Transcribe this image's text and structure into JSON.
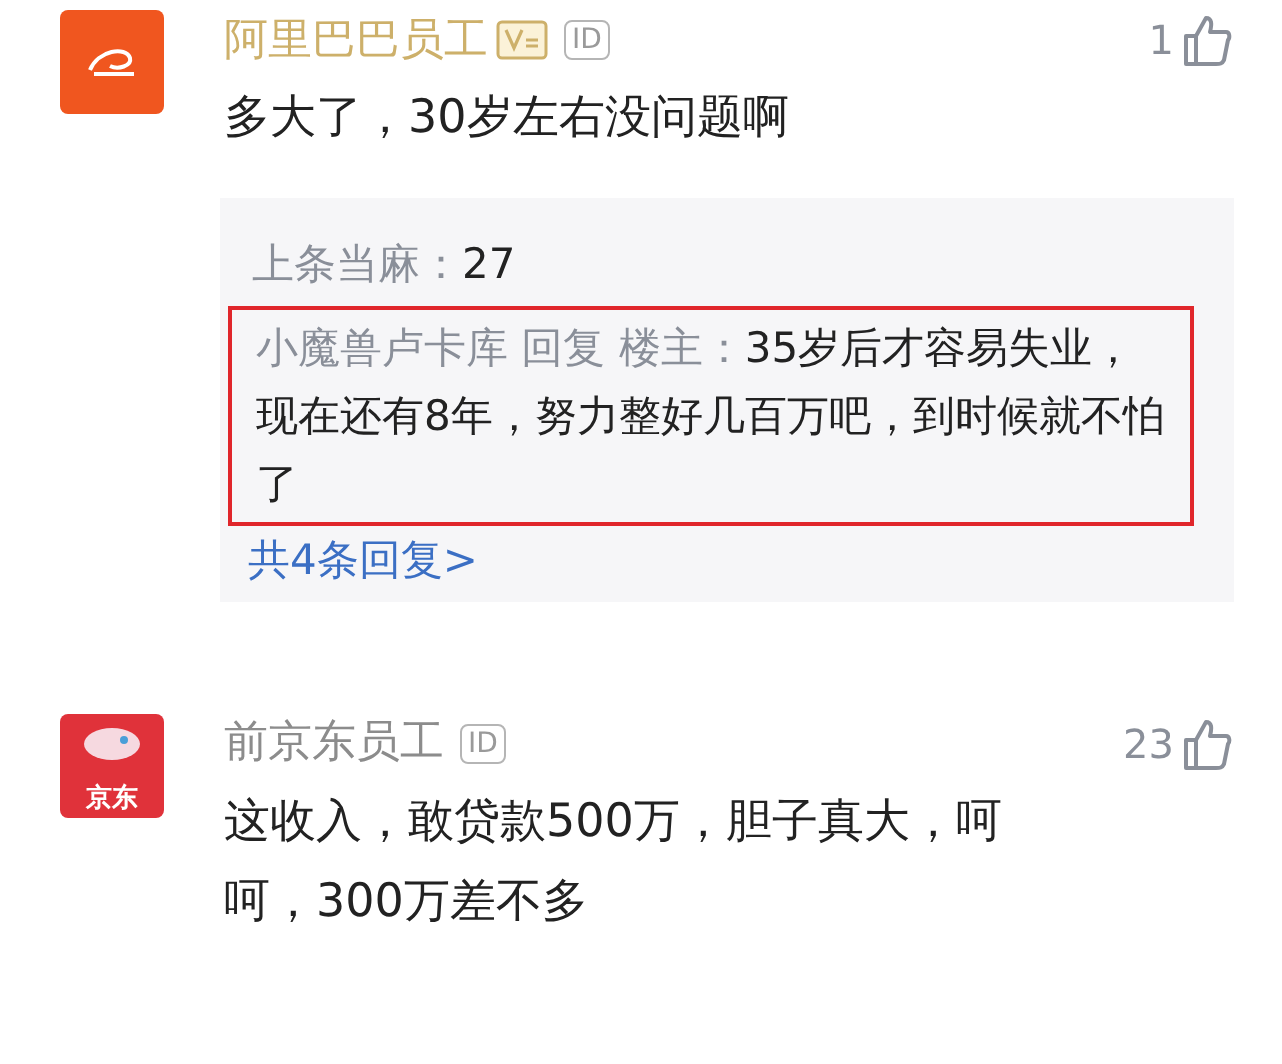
{
  "comments": [
    {
      "avatar": {
        "kind": "alibaba"
      },
      "name": "阿里巴巴员工",
      "vip": true,
      "id_badge": "ID",
      "likes": "1",
      "text": "多大了，30岁左右没问题啊",
      "replies": [
        {
          "author": "上条当麻：",
          "text": "27",
          "highlighted": false
        },
        {
          "author": "小魔兽卢卡库 回复 楼主：",
          "text": "35岁后才容易失业，现在还有8年，努力整好几百万吧，到时候就不怕了",
          "highlighted": true
        }
      ],
      "more_replies": "共4条回复>"
    },
    {
      "avatar": {
        "kind": "jd",
        "label": "京东"
      },
      "name": "前京东员工",
      "vip": false,
      "id_badge": "ID",
      "likes": "23",
      "text": "这收入，敢贷款500万，胆子真大，呵呵，300万差不多"
    }
  ]
}
